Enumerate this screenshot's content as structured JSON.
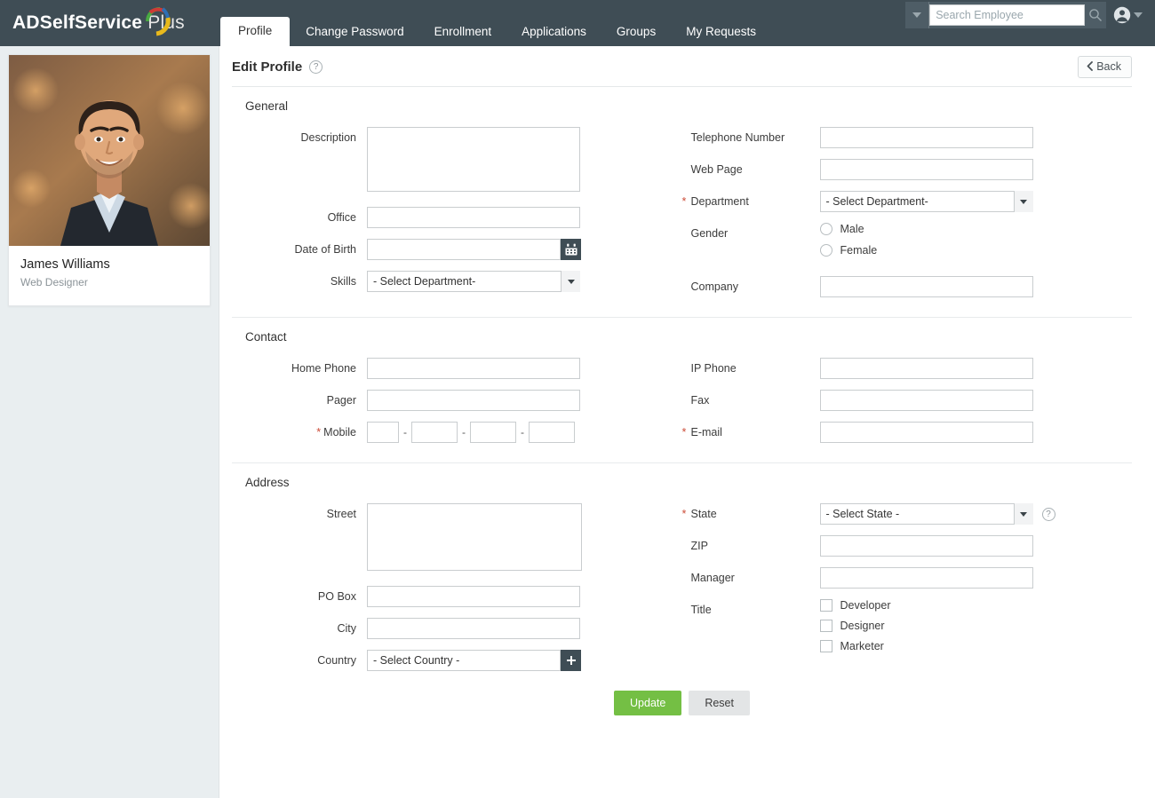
{
  "app": {
    "logo_bold": "ADSelfService",
    "logo_light": "Plus",
    "accent_green": "#74bf44",
    "header_bg": "#3f4d55"
  },
  "nav": {
    "tabs": [
      {
        "label": "Profile",
        "active": true
      },
      {
        "label": "Change Password",
        "active": false
      },
      {
        "label": "Enrollment",
        "active": false
      },
      {
        "label": "Applications",
        "active": false
      },
      {
        "label": "Groups",
        "active": false
      },
      {
        "label": "My Requests",
        "active": false
      }
    ]
  },
  "search": {
    "placeholder": "Search Employee",
    "value": "",
    "dropdown_icon": "caret-down-icon",
    "icon": "search-icon"
  },
  "user_menu": {
    "icon": "user-avatar-icon",
    "caret": "caret-down-icon"
  },
  "sidebar": {
    "avatar_alt": "employee-photo",
    "name": "James Williams",
    "role": "Web Designer"
  },
  "header": {
    "title": "Edit Profile",
    "help_icon": "question-mark-icon",
    "back_label": "Back",
    "back_icon": "chevron-left-icon"
  },
  "sections": {
    "general": {
      "title": "General",
      "description": {
        "label": "Description",
        "value": ""
      },
      "office": {
        "label": "Office",
        "value": ""
      },
      "date_of_birth": {
        "label": "Date of Birth",
        "value": "",
        "icon": "calendar-icon"
      },
      "skills": {
        "label": "Skills",
        "selected": "- Select Department-"
      },
      "telephone_number": {
        "label": "Telephone Number",
        "value": ""
      },
      "web_page": {
        "label": "Web Page",
        "value": ""
      },
      "department": {
        "label": "Department",
        "required": "*",
        "selected": "- Select Department-"
      },
      "gender": {
        "label": "Gender",
        "options": [
          {
            "label": "Male",
            "checked": false
          },
          {
            "label": "Female",
            "checked": false
          }
        ]
      },
      "company": {
        "label": "Company",
        "value": "",
        "readonly": true
      }
    },
    "contact": {
      "title": "Contact",
      "home_phone": {
        "label": "Home Phone",
        "value": ""
      },
      "pager": {
        "label": "Pager",
        "value": ""
      },
      "mobile": {
        "label": "Mobile",
        "required": "*",
        "separator": "-",
        "parts": [
          "",
          "",
          "",
          ""
        ]
      },
      "ip_phone": {
        "label": "IP Phone",
        "value": ""
      },
      "fax": {
        "label": "Fax",
        "value": ""
      },
      "email": {
        "label": "E-mail",
        "required": "*",
        "value": ""
      }
    },
    "address": {
      "title": "Address",
      "street": {
        "label": "Street",
        "value": ""
      },
      "po_box": {
        "label": "PO Box",
        "value": ""
      },
      "city": {
        "label": "City",
        "value": ""
      },
      "country": {
        "label": "Country",
        "selected": "- Select Country -",
        "add_icon": "plus-icon"
      },
      "state": {
        "label": "State",
        "required": "*",
        "selected": "- Select State -",
        "help_icon": "question-mark-icon"
      },
      "zip": {
        "label": "ZIP",
        "value": ""
      },
      "manager": {
        "label": "Manager",
        "value": "",
        "readonly": true
      },
      "title_field": {
        "label": "Title",
        "options": [
          {
            "label": "Developer",
            "checked": false
          },
          {
            "label": "Designer",
            "checked": false
          },
          {
            "label": "Marketer",
            "checked": false
          }
        ]
      }
    }
  },
  "actions": {
    "update_label": "Update",
    "reset_label": "Reset"
  }
}
